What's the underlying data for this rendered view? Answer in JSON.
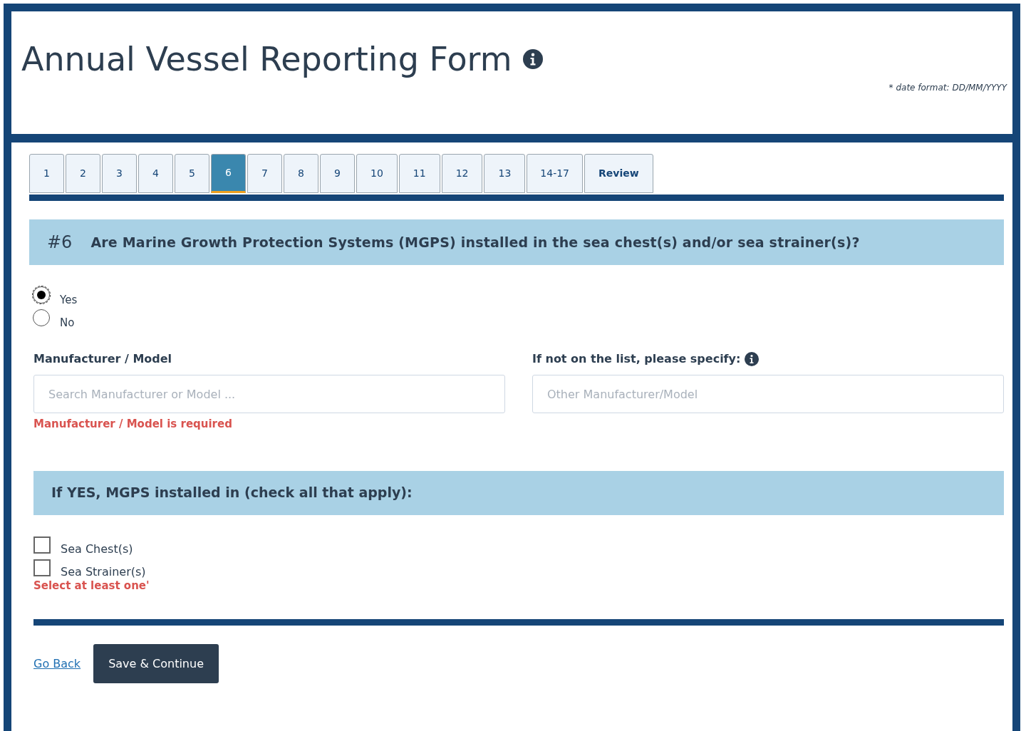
{
  "header": {
    "title": "Annual Vessel Reporting Form",
    "date_note": "* date format: DD/MM/YYYY"
  },
  "tabs": [
    {
      "label": "1",
      "selected": false,
      "kind": "step"
    },
    {
      "label": "2",
      "selected": false,
      "kind": "step"
    },
    {
      "label": "3",
      "selected": false,
      "kind": "step"
    },
    {
      "label": "4",
      "selected": false,
      "kind": "step"
    },
    {
      "label": "5",
      "selected": false,
      "kind": "step"
    },
    {
      "label": "6",
      "selected": true,
      "kind": "step"
    },
    {
      "label": "7",
      "selected": false,
      "kind": "step"
    },
    {
      "label": "8",
      "selected": false,
      "kind": "step"
    },
    {
      "label": "9",
      "selected": false,
      "kind": "step"
    },
    {
      "label": "10",
      "selected": false,
      "kind": "step"
    },
    {
      "label": "11",
      "selected": false,
      "kind": "step"
    },
    {
      "label": "12",
      "selected": false,
      "kind": "step"
    },
    {
      "label": "13",
      "selected": false,
      "kind": "step"
    },
    {
      "label": "14-17",
      "selected": false,
      "kind": "step"
    },
    {
      "label": "Review",
      "selected": false,
      "kind": "review"
    }
  ],
  "question": {
    "number": "#6",
    "text": "Are Marine Growth Protection Systems (MGPS) installed in the sea chest(s) and/or sea strainer(s)?"
  },
  "answers": [
    {
      "label": "Yes",
      "selected": true
    },
    {
      "label": "No",
      "selected": false
    }
  ],
  "fields": [
    {
      "label": "Manufacturer / Model",
      "placeholder": "Search Manufacturer or Model ...",
      "info": false,
      "error": "Manufacturer / Model is required"
    },
    {
      "label": "If not on the list, please specify:",
      "placeholder": "Other Manufacturer/Model",
      "info": true
    }
  ],
  "locations": {
    "heading": "If YES, MGPS installed in (check all that apply):",
    "options": [
      {
        "label": "Sea Chest(s)",
        "checked": false
      },
      {
        "label": "Sea Strainer(s)",
        "checked": false
      }
    ],
    "error": "Select at least one'"
  },
  "actions": {
    "back": "Go Back",
    "submit": "Save & Continue"
  }
}
